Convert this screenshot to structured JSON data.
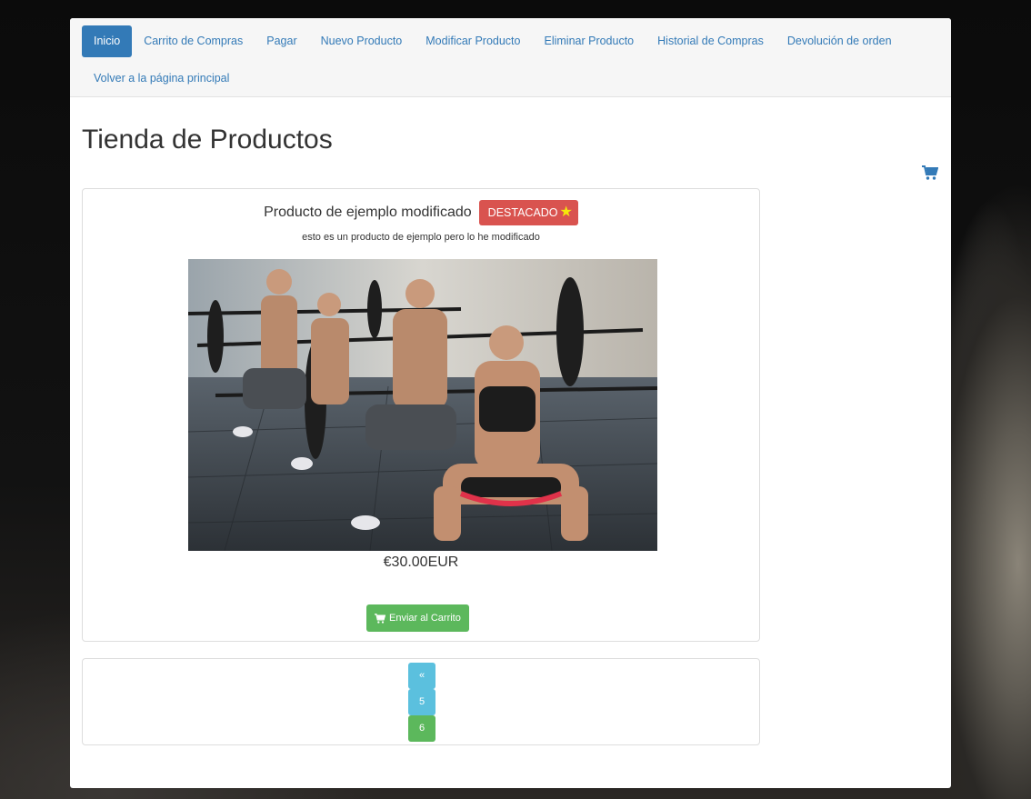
{
  "nav": {
    "items": [
      {
        "label": "Inicio",
        "active": true
      },
      {
        "label": "Carrito de Compras"
      },
      {
        "label": "Pagar"
      },
      {
        "label": "Nuevo Producto"
      },
      {
        "label": "Modificar Producto"
      },
      {
        "label": "Eliminar Producto"
      },
      {
        "label": "Historial de Compras"
      },
      {
        "label": "Devolución de orden"
      }
    ],
    "second_row": {
      "label": "Volver a la página principal"
    }
  },
  "page": {
    "title": "Tienda de Productos"
  },
  "product": {
    "name": "Producto de ejemplo modificado",
    "badge": "DESTACADO",
    "description": "esto es un producto de ejemplo pero lo he modificado",
    "price": "€30.00EUR",
    "add_to_cart": "Enviar al Carrito"
  },
  "pagination": {
    "prev": "«",
    "pages": [
      "5",
      "6"
    ]
  },
  "colors": {
    "primary": "#337ab7",
    "danger": "#d9534f",
    "success": "#5cb85c",
    "info": "#5bc0de",
    "star": "#f5e90a"
  },
  "icons": {
    "cart": "cart-icon",
    "star": "star-icon"
  }
}
